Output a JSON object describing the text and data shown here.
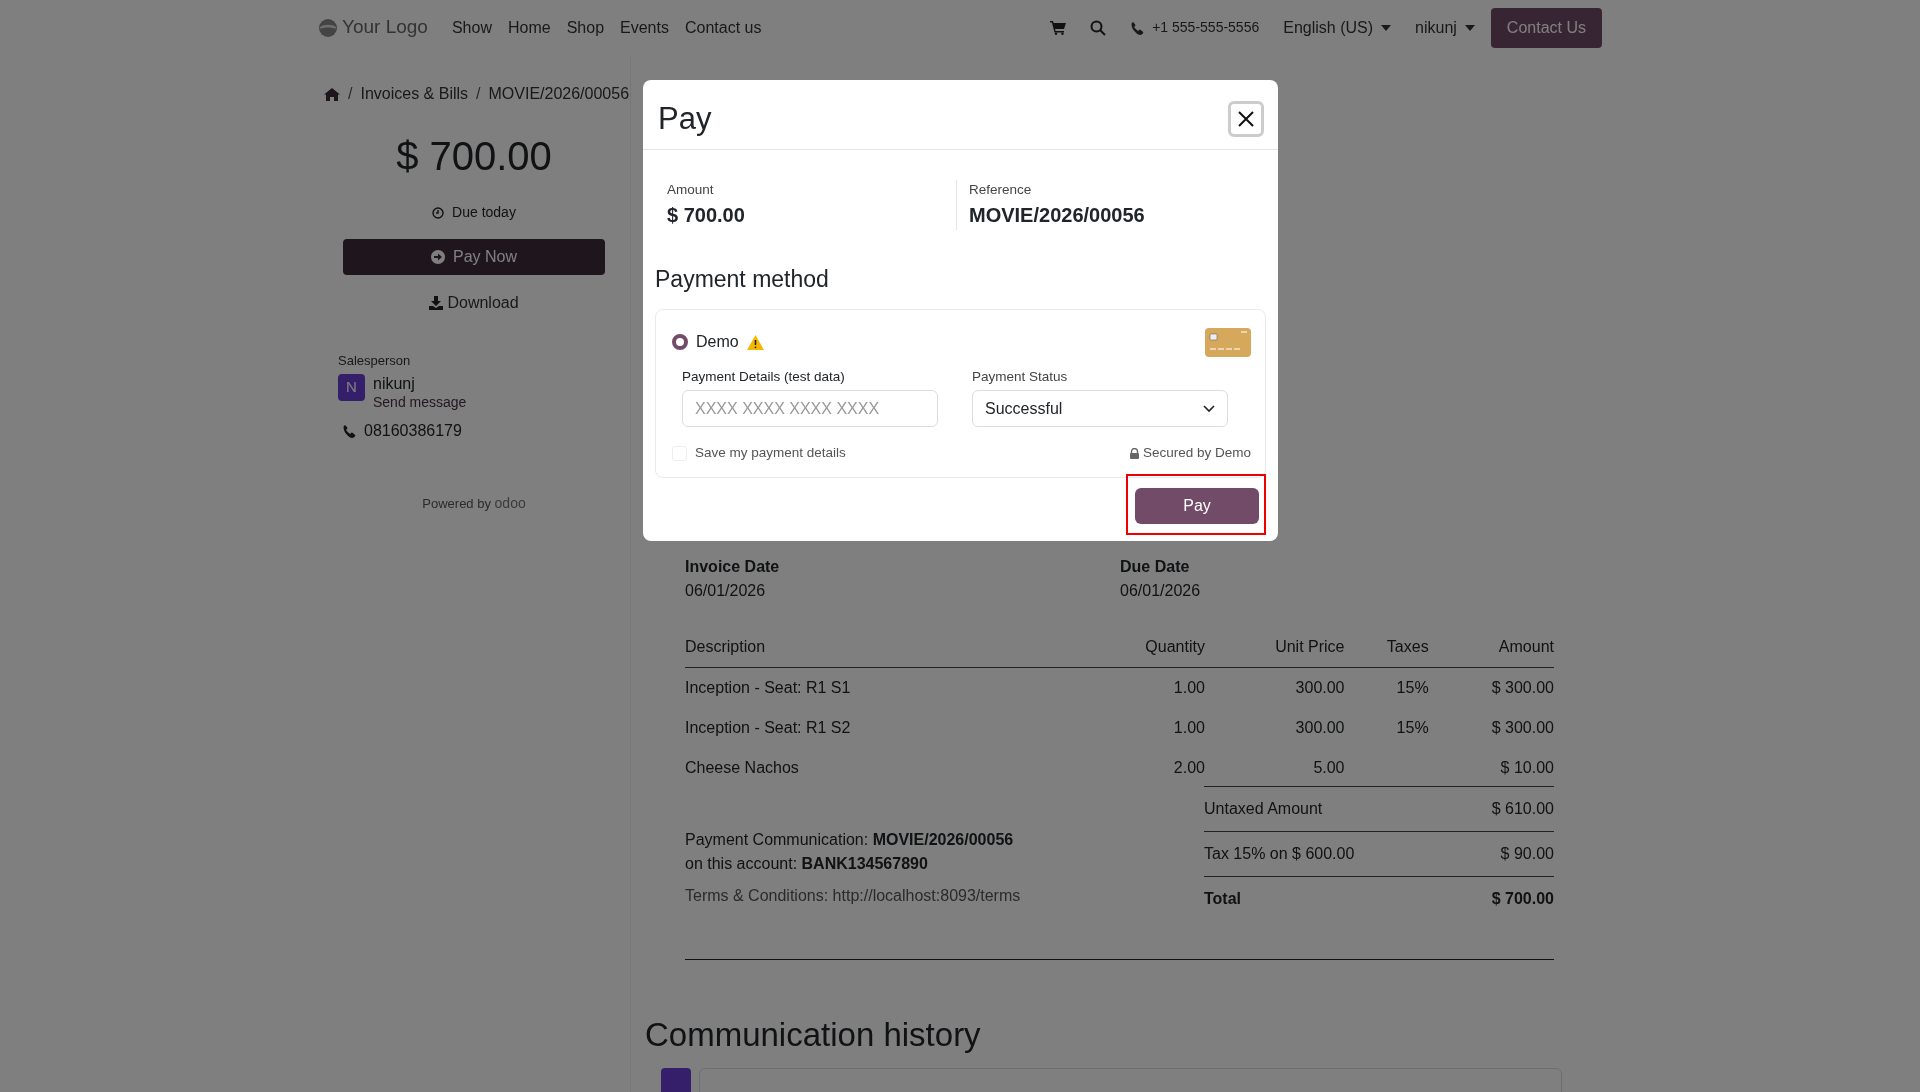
{
  "navbar": {
    "logo": "Your Logo",
    "links": [
      "Show",
      "Home",
      "Shop",
      "Events",
      "Contact us"
    ],
    "phone": "+1 555-555-5556",
    "language": "English (US)",
    "user": "nikunj",
    "cta": "Contact Us"
  },
  "breadcrumb": {
    "separator": "/",
    "items": [
      "Invoices & Bills",
      "MOVIE/2026/00056"
    ]
  },
  "summary": {
    "amount": "$ 700.00",
    "due": "Due today",
    "pay_button": "Pay Now",
    "download": "Download"
  },
  "salesperson": {
    "label": "Salesperson",
    "initial": "N",
    "name": "nikunj",
    "message_link": "Send message",
    "phone": "08160386179"
  },
  "powered_by": {
    "text": "Powered by",
    "brand": "odoo"
  },
  "invoice": {
    "dates": [
      {
        "label": "Invoice Date",
        "value": "06/01/2026"
      },
      {
        "label": "Due Date",
        "value": "06/01/2026"
      }
    ],
    "columns": [
      "Description",
      "Quantity",
      "Unit Price",
      "Taxes",
      "Amount"
    ],
    "rows": [
      [
        "Inception - Seat: R1 S1",
        "1.00",
        "300.00",
        "15%",
        "$ 300.00"
      ],
      [
        "Inception - Seat: R1 S2",
        "1.00",
        "300.00",
        "15%",
        "$ 300.00"
      ],
      [
        "Cheese Nachos",
        "2.00",
        "5.00",
        "",
        "$ 10.00"
      ]
    ],
    "totals": [
      {
        "label": "Untaxed Amount",
        "value": "$ 610.00",
        "bold": false
      },
      {
        "label": "Tax 15% on $ 600.00",
        "value": "$ 90.00",
        "bold": false
      },
      {
        "label": "Total",
        "value": "$ 700.00",
        "bold": true
      }
    ],
    "payment_communication": "Payment Communication: **MOVIE/2026/00056**",
    "account": "on this account: **BANK134567890**",
    "terms": "Terms & Conditions: http://localhost:8093/terms"
  },
  "communication_history": {
    "title": "Communication history"
  },
  "modal": {
    "title": "Pay",
    "amount_label": "Amount",
    "amount": "$ 700.00",
    "reference_label": "Reference",
    "reference": "MOVIE/2026/00056",
    "section_title": "Payment method",
    "methods": [
      {
        "name": "Demo",
        "selected": true,
        "warning": true
      }
    ],
    "details_label": "Payment Details (test data)",
    "details_placeholder": "XXXX XXXX XXXX XXXX",
    "status_label": "Payment Status",
    "status_value": "Successful",
    "save_label": "Save my payment details",
    "save_checked": false,
    "secured": "Secured by Demo",
    "pay_button": "Pay",
    "pay_highlighted": true
  }
}
